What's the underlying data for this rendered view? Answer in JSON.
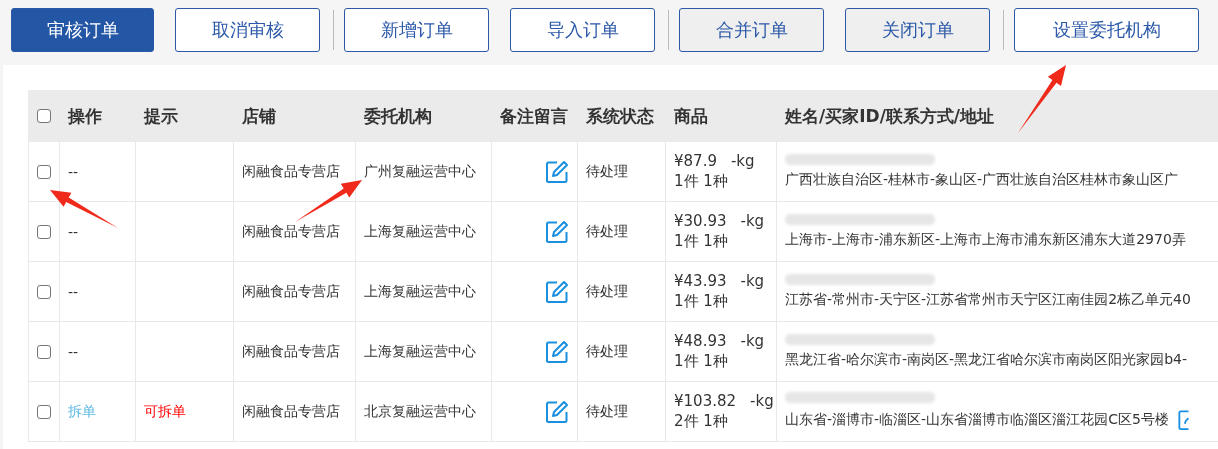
{
  "toolbar": {
    "groups": [
      {
        "buttons": [
          {
            "label": "审核订单",
            "kind": "primary"
          },
          {
            "label": "取消审核",
            "kind": "outline"
          }
        ]
      },
      {
        "buttons": [
          {
            "label": "新增订单",
            "kind": "outline"
          },
          {
            "label": "导入订单",
            "kind": "outline"
          }
        ]
      },
      {
        "buttons": [
          {
            "label": "合并订单",
            "kind": "grey"
          },
          {
            "label": "关闭订单",
            "kind": "grey"
          }
        ]
      },
      {
        "buttons": [
          {
            "label": "设置委托机构",
            "kind": "outline"
          }
        ]
      }
    ]
  },
  "table": {
    "select_all": {
      "checked": false
    },
    "columns": [
      "操作",
      "提示",
      "店铺",
      "委托机构",
      "备注留言",
      "系统状态",
      "商品",
      "姓名/买家ID/联系方式/地址"
    ],
    "rows": [
      {
        "checked": false,
        "action": {
          "label": "--",
          "kind": "text"
        },
        "shop": "闲融食品专营店",
        "agency": "广州复融运营中心",
        "status": "待处理",
        "price": "¥87.9",
        "weight": "-kg",
        "quantity": "1件 1种",
        "address": "广西壮族自治区-桂林市-象山区-广西壮族自治区桂林市象山区广",
        "address_edit": false
      },
      {
        "checked": false,
        "action": {
          "label": "--",
          "kind": "text"
        },
        "shop": "闲融食品专营店",
        "agency": "上海复融运营中心",
        "status": "待处理",
        "price": "¥30.93",
        "weight": "-kg",
        "quantity": "1件 1种",
        "address": "上海市-上海市-浦东新区-上海市上海市浦东新区浦东大道2970弄",
        "address_edit": false
      },
      {
        "checked": false,
        "action": {
          "label": "--",
          "kind": "text"
        },
        "shop": "闲融食品专营店",
        "agency": "上海复融运营中心",
        "status": "待处理",
        "price": "¥43.93",
        "weight": "-kg",
        "quantity": "1件 1种",
        "address": "江苏省-常州市-天宁区-江苏省常州市天宁区江南佳园2栋乙单元40",
        "address_edit": false
      },
      {
        "checked": false,
        "action": {
          "label": "--",
          "kind": "text"
        },
        "shop": "闲融食品专营店",
        "agency": "上海复融运营中心",
        "status": "待处理",
        "price": "¥48.93",
        "weight": "-kg",
        "quantity": "1件 1种",
        "address": "黑龙江省-哈尔滨市-南岗区-黑龙江省哈尔滨市南岗区阳光家园b4-",
        "address_edit": false
      },
      {
        "checked": false,
        "action": {
          "label": "拆单",
          "kind": "link"
        },
        "hint": "可拆单",
        "shop": "闲融食品专营店",
        "agency": "北京复融运营中心",
        "status": "待处理",
        "price": "¥103.82",
        "weight": "-kg",
        "quantity": "2件 1种",
        "address": "山东省-淄博市-临淄区-山东省淄博市临淄区淄江花园C区5号楼",
        "address_edit": true
      }
    ]
  }
}
